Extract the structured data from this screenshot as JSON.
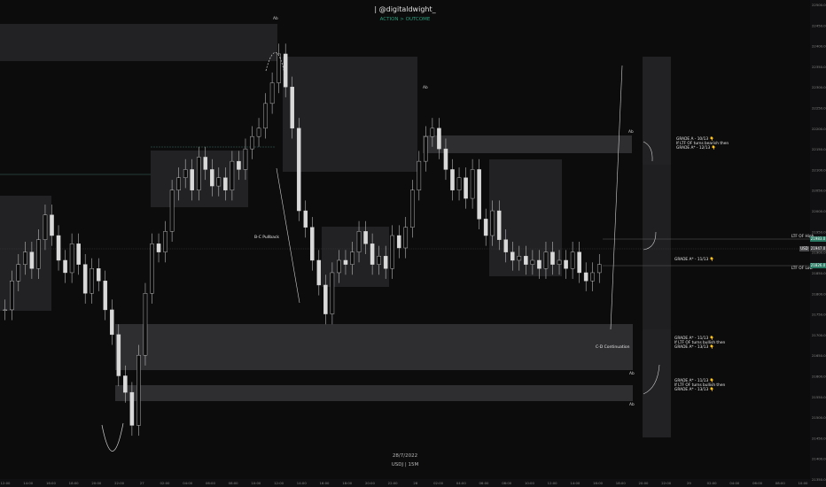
{
  "header": {
    "brand": "| @digitaldwight_",
    "tagline": "ACTION > OUTCOME"
  },
  "footer": {
    "date": "28/7/2022",
    "pair": "USDJ | 15M"
  },
  "annotations": {
    "bc_pullback": "B-C Pullback",
    "cd_continuation": "C-D Continuation",
    "a_top": "Ab",
    "b_mid": "Ab",
    "c_right": "Ab",
    "d_r1": "Ab",
    "d_r2": "Ab"
  },
  "notes": {
    "top": [
      "GRADE A - 10/13 👇",
      "If LTF OF turns bearish then",
      "GRADE A* - 12/13 👇"
    ],
    "mid": [
      "GRADE A* - 11/13 👇"
    ],
    "low1": [
      "GRADE A* - 11/13 👇",
      "If LTF OF turns bullish then",
      "GRADE A* - 13/13 👇"
    ],
    "low2": [
      "GRADE A* - 11/13 👇",
      "If LTF OF turns bullish then",
      "GRADE A* - 13/13 👇"
    ]
  },
  "levels": {
    "ltf_high": "LTF OF High",
    "ltf_low": "LTF OF Low",
    "price_high_tag": "21983.0",
    "price_mid_tag": "21947.0",
    "price_low_tag": "21826.0",
    "price_usd_tag": "USD"
  },
  "colors": {
    "background": "#0c0c0d",
    "zone": "#2a2a2d",
    "zone_light": "#3a3a3d",
    "candle": "#d9d9d9",
    "accent_green": "#2a9d7a",
    "level_line": "#3b6e5e"
  },
  "chart_data": {
    "type": "candlestick",
    "title": "",
    "x_time_labels": [
      "12:00",
      "14:00",
      "16:00",
      "18:00",
      "20:00",
      "22:00",
      "27",
      "02:00",
      "04:00",
      "06:00",
      "08:00",
      "10:00",
      "12:00",
      "14:00",
      "16:00",
      "18:00",
      "20:00",
      "22:00",
      "28",
      "02:00",
      "04:00",
      "06:00",
      "08:00",
      "10:00",
      "12:00",
      "14:00",
      "16:00",
      "18:00",
      "20:00",
      "22:00",
      "29",
      "02:00",
      "04:00",
      "06:00",
      "08:00",
      "10:00"
    ],
    "y_price_labels": [
      "22500.0",
      "22450.0",
      "22400.0",
      "22350.0",
      "22300.0",
      "22250.0",
      "22200.0",
      "22150.0",
      "22100.0",
      "22050.0",
      "22000.0",
      "21950.0",
      "21900.0",
      "21850.0",
      "21800.0",
      "21750.0",
      "21700.0",
      "21650.0",
      "21600.0",
      "21550.0",
      "21500.0",
      "21450.0",
      "21400.0",
      "21350.0"
    ],
    "close_path": [
      21760,
      21830,
      21870,
      21900,
      21860,
      21930,
      21990,
      21940,
      21880,
      21850,
      21920,
      21870,
      21800,
      21860,
      21830,
      21760,
      21700,
      21600,
      21560,
      21480,
      21650,
      21800,
      21920,
      21900,
      21950,
      22050,
      22080,
      22100,
      22050,
      22130,
      22100,
      22060,
      22080,
      22050,
      22120,
      22100,
      22150,
      22180,
      22200,
      22260,
      22310,
      22380,
      22300,
      22200,
      22000,
      21960,
      21880,
      21820,
      21750,
      21850,
      21880,
      21870,
      21900,
      21950,
      21920,
      21870,
      21890,
      21860,
      21940,
      21910,
      21960,
      22050,
      22120,
      22180,
      22200,
      22150,
      22100,
      22050,
      22080,
      22030,
      22100,
      21980,
      21940,
      22000,
      21930,
      21900,
      21880,
      21890,
      21870,
      21880,
      21860,
      21900,
      21870,
      21880,
      21860,
      21900,
      21850,
      21830,
      21850,
      21870
    ]
  }
}
